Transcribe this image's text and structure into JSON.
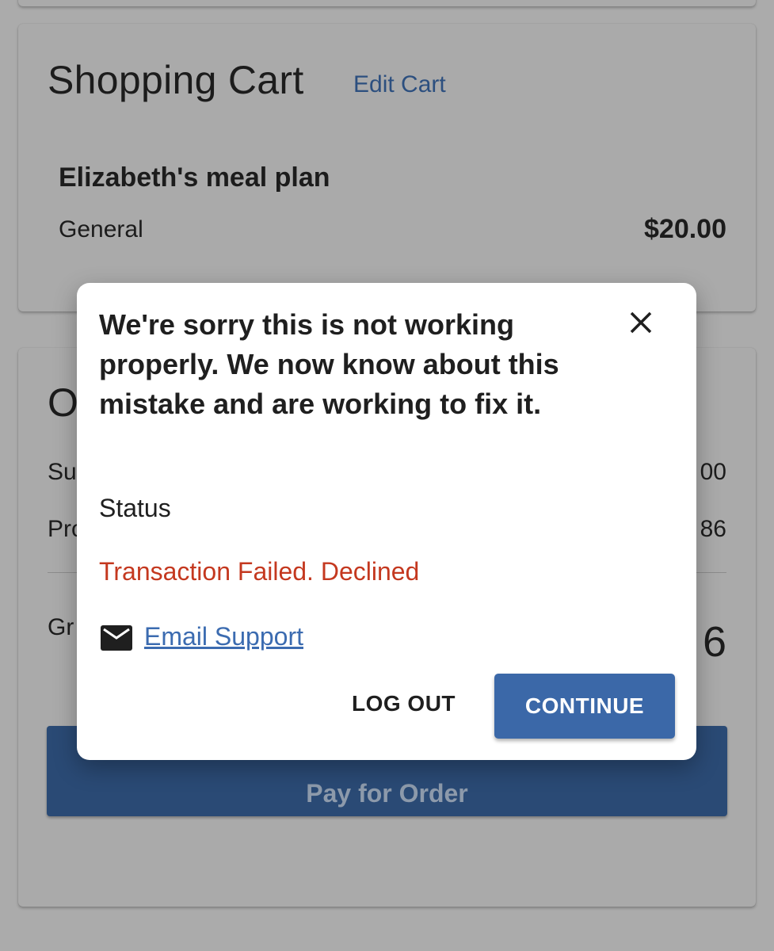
{
  "cart": {
    "title": "Shopping Cart",
    "edit_label": "Edit Cart",
    "item_name": "Elizabeth's meal plan",
    "item_type": "General",
    "item_price": "$20.00"
  },
  "summary": {
    "title_fragment": "O",
    "subtotal_label_fragment": "Su",
    "subtotal_value_fragment": "00",
    "processing_label_fragment": "Pro",
    "processing_value_fragment": "86",
    "grand_label_fragment": "Gr",
    "grand_value_fragment": "6",
    "pay_button_label": "Pay for Order"
  },
  "dialog": {
    "message": "We're sorry this is not working properly. We now know about this mistake and are working to fix it.",
    "status_label": "Status",
    "status_value": "Transaction Failed. Declined",
    "email_support_label": "Email Support",
    "logout_label": "LOG OUT",
    "continue_label": "CONTINUE",
    "close_icon": "close-icon",
    "mail_icon": "mail-icon"
  },
  "colors": {
    "backdrop": "#ababab",
    "link": "#3b6bb0",
    "error": "#c4381f",
    "primary_button": "#3b68a8",
    "pay_button": "#2a4a75"
  }
}
